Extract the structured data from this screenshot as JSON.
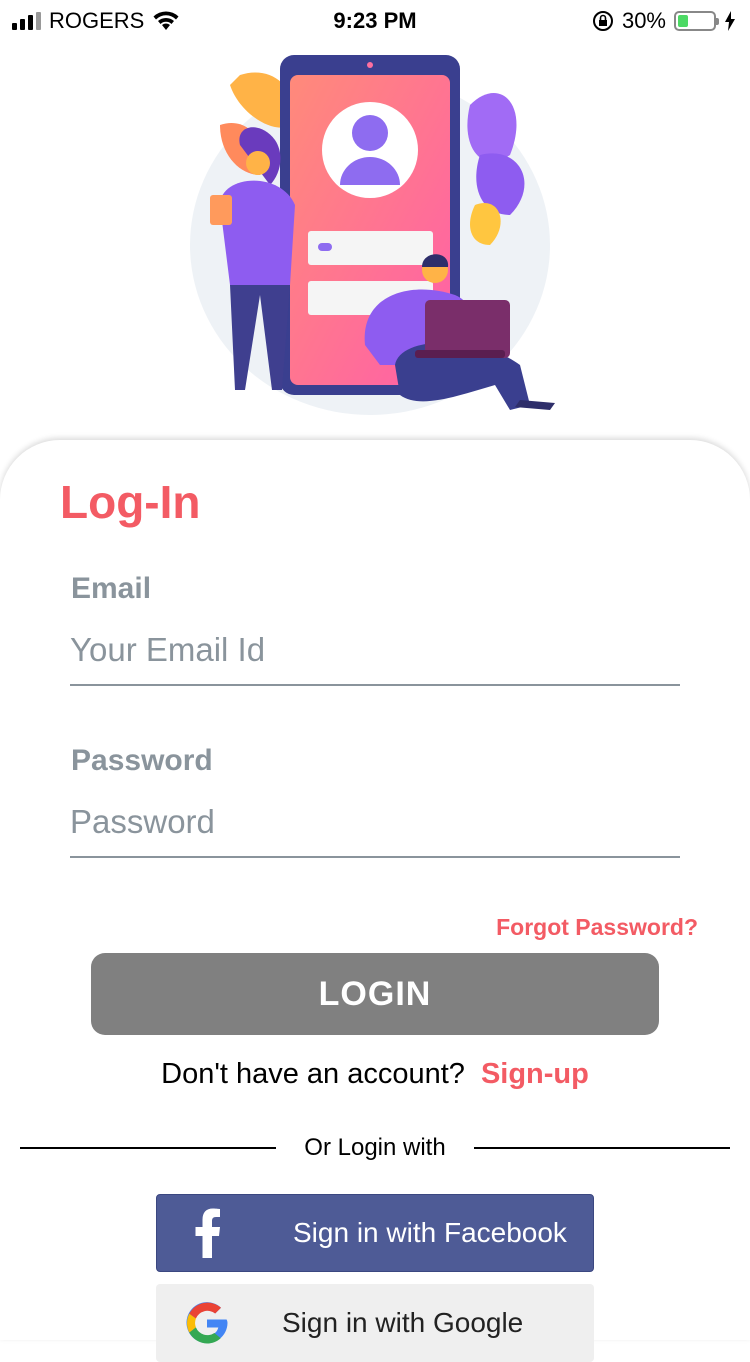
{
  "status_bar": {
    "carrier": "ROGERS",
    "time": "9:23 PM",
    "battery_percent": "30%",
    "battery_level": 0.3
  },
  "login": {
    "title": "Log-In",
    "email_label": "Email",
    "email_placeholder": "Your Email Id",
    "password_label": "Password",
    "password_placeholder": "Password",
    "forgot_password": "Forgot Password?",
    "login_button": "LOGIN",
    "no_account_text": "Don't have an account?",
    "signup_link": "Sign-up",
    "or_login_with": "Or Login with"
  },
  "social": {
    "facebook_label": "Sign in with Facebook",
    "google_label": "Sign in with Google"
  },
  "colors": {
    "accent": "#f35b64",
    "facebook": "#4e5b96",
    "login_button": "#808080",
    "label_gray": "#8a949c"
  }
}
